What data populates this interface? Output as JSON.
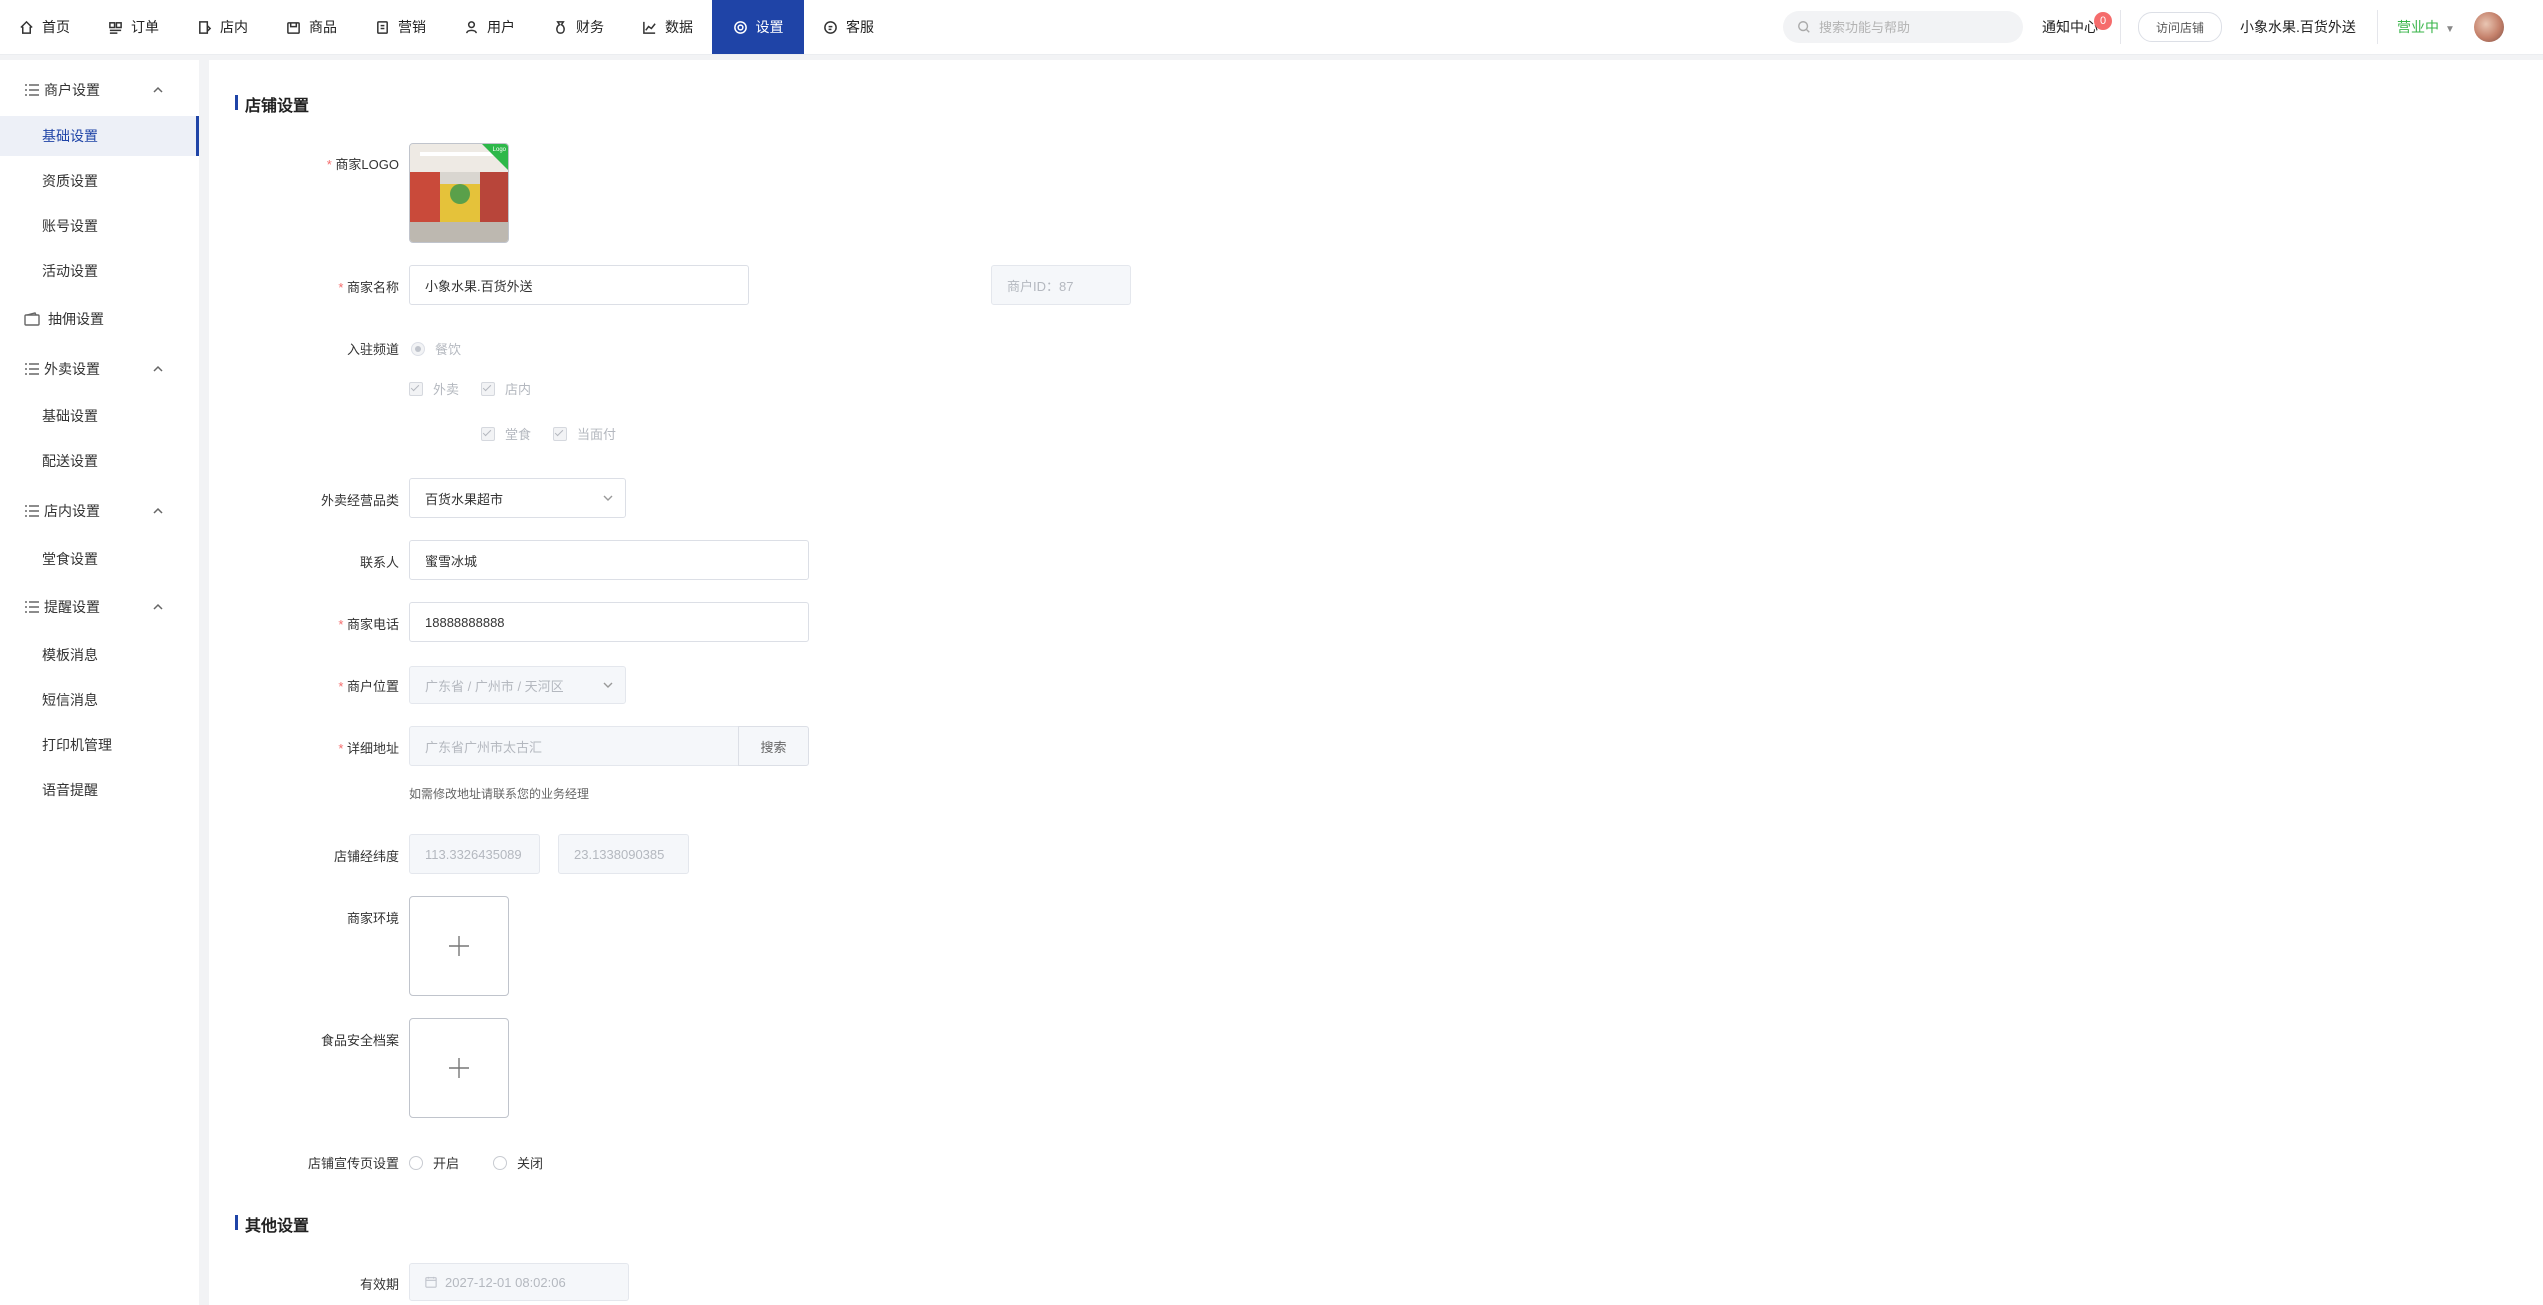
{
  "nav": {
    "items": [
      {
        "label": "首页",
        "icon": "home-icon"
      },
      {
        "label": "订单",
        "icon": "order-icon"
      },
      {
        "label": "店内",
        "icon": "store-icon"
      },
      {
        "label": "商品",
        "icon": "goods-icon"
      },
      {
        "label": "营销",
        "icon": "marketing-icon"
      },
      {
        "label": "用户",
        "icon": "user-icon"
      },
      {
        "label": "财务",
        "icon": "finance-icon"
      },
      {
        "label": "数据",
        "icon": "chart-icon"
      },
      {
        "label": "设置",
        "icon": "gear-icon",
        "active": true
      },
      {
        "label": "客服",
        "icon": "chat-icon"
      }
    ],
    "search_placeholder": "搜索功能与帮助",
    "notice_label": "通知中心",
    "notice_count": "0",
    "visit_label": "访问店铺",
    "shop_name": "小象水果.百货外送",
    "status_label": "营业中",
    "accent_color": "#1f44a7",
    "status_color": "#39b54a"
  },
  "sidebar": {
    "groups": [
      {
        "label": "商户设置",
        "items": [
          "基础设置",
          "资质设置",
          "账号设置",
          "活动设置"
        ]
      },
      {
        "label": "抽佣设置",
        "items": []
      },
      {
        "label": "外卖设置",
        "items": [
          "基础设置",
          "配送设置"
        ]
      },
      {
        "label": "店内设置",
        "items": [
          "堂食设置"
        ]
      },
      {
        "label": "提醒设置",
        "items": [
          "模板消息",
          "短信消息",
          "打印机管理",
          "语音提醒"
        ]
      }
    ],
    "active_item": "基础设置"
  },
  "form": {
    "section_title": "店铺设置",
    "logo_label": "商家LOGO",
    "logo_tag": "Logo",
    "name_label": "商家名称",
    "name_value": "小象水果.百货外送",
    "merchant_id": "商户ID：87",
    "channel_label": "入驻频道",
    "channel_radio": "餐饮",
    "channel_checks": [
      "外卖",
      "店内"
    ],
    "channel_sub_checks": [
      "堂食",
      "当面付"
    ],
    "category_label": "外卖经营品类",
    "category_value": "百货水果超市",
    "contact_label": "联系人",
    "contact_value": "蜜雪冰城",
    "phone_label": "商家电话",
    "phone_value": "18888888888",
    "location_label": "商户位置",
    "location_value": "广东省 / 广州市 / 天河区",
    "address_label": "详细地址",
    "address_value": "广东省广州市太古汇",
    "search_button": "搜索",
    "address_hint": "如需修改地址请联系您的业务经理",
    "coords_label": "店铺经纬度",
    "longitude": "113.3326435089",
    "latitude": "23.1338090385",
    "environment_label": "商家环境",
    "food_safety_label": "食品安全档案",
    "promo_label": "店铺宣传页设置",
    "promo_on": "开启",
    "promo_off": "关闭",
    "other_title": "其他设置",
    "expiry_label": "有效期",
    "expiry_value": "2027-12-01 08:02:06"
  }
}
